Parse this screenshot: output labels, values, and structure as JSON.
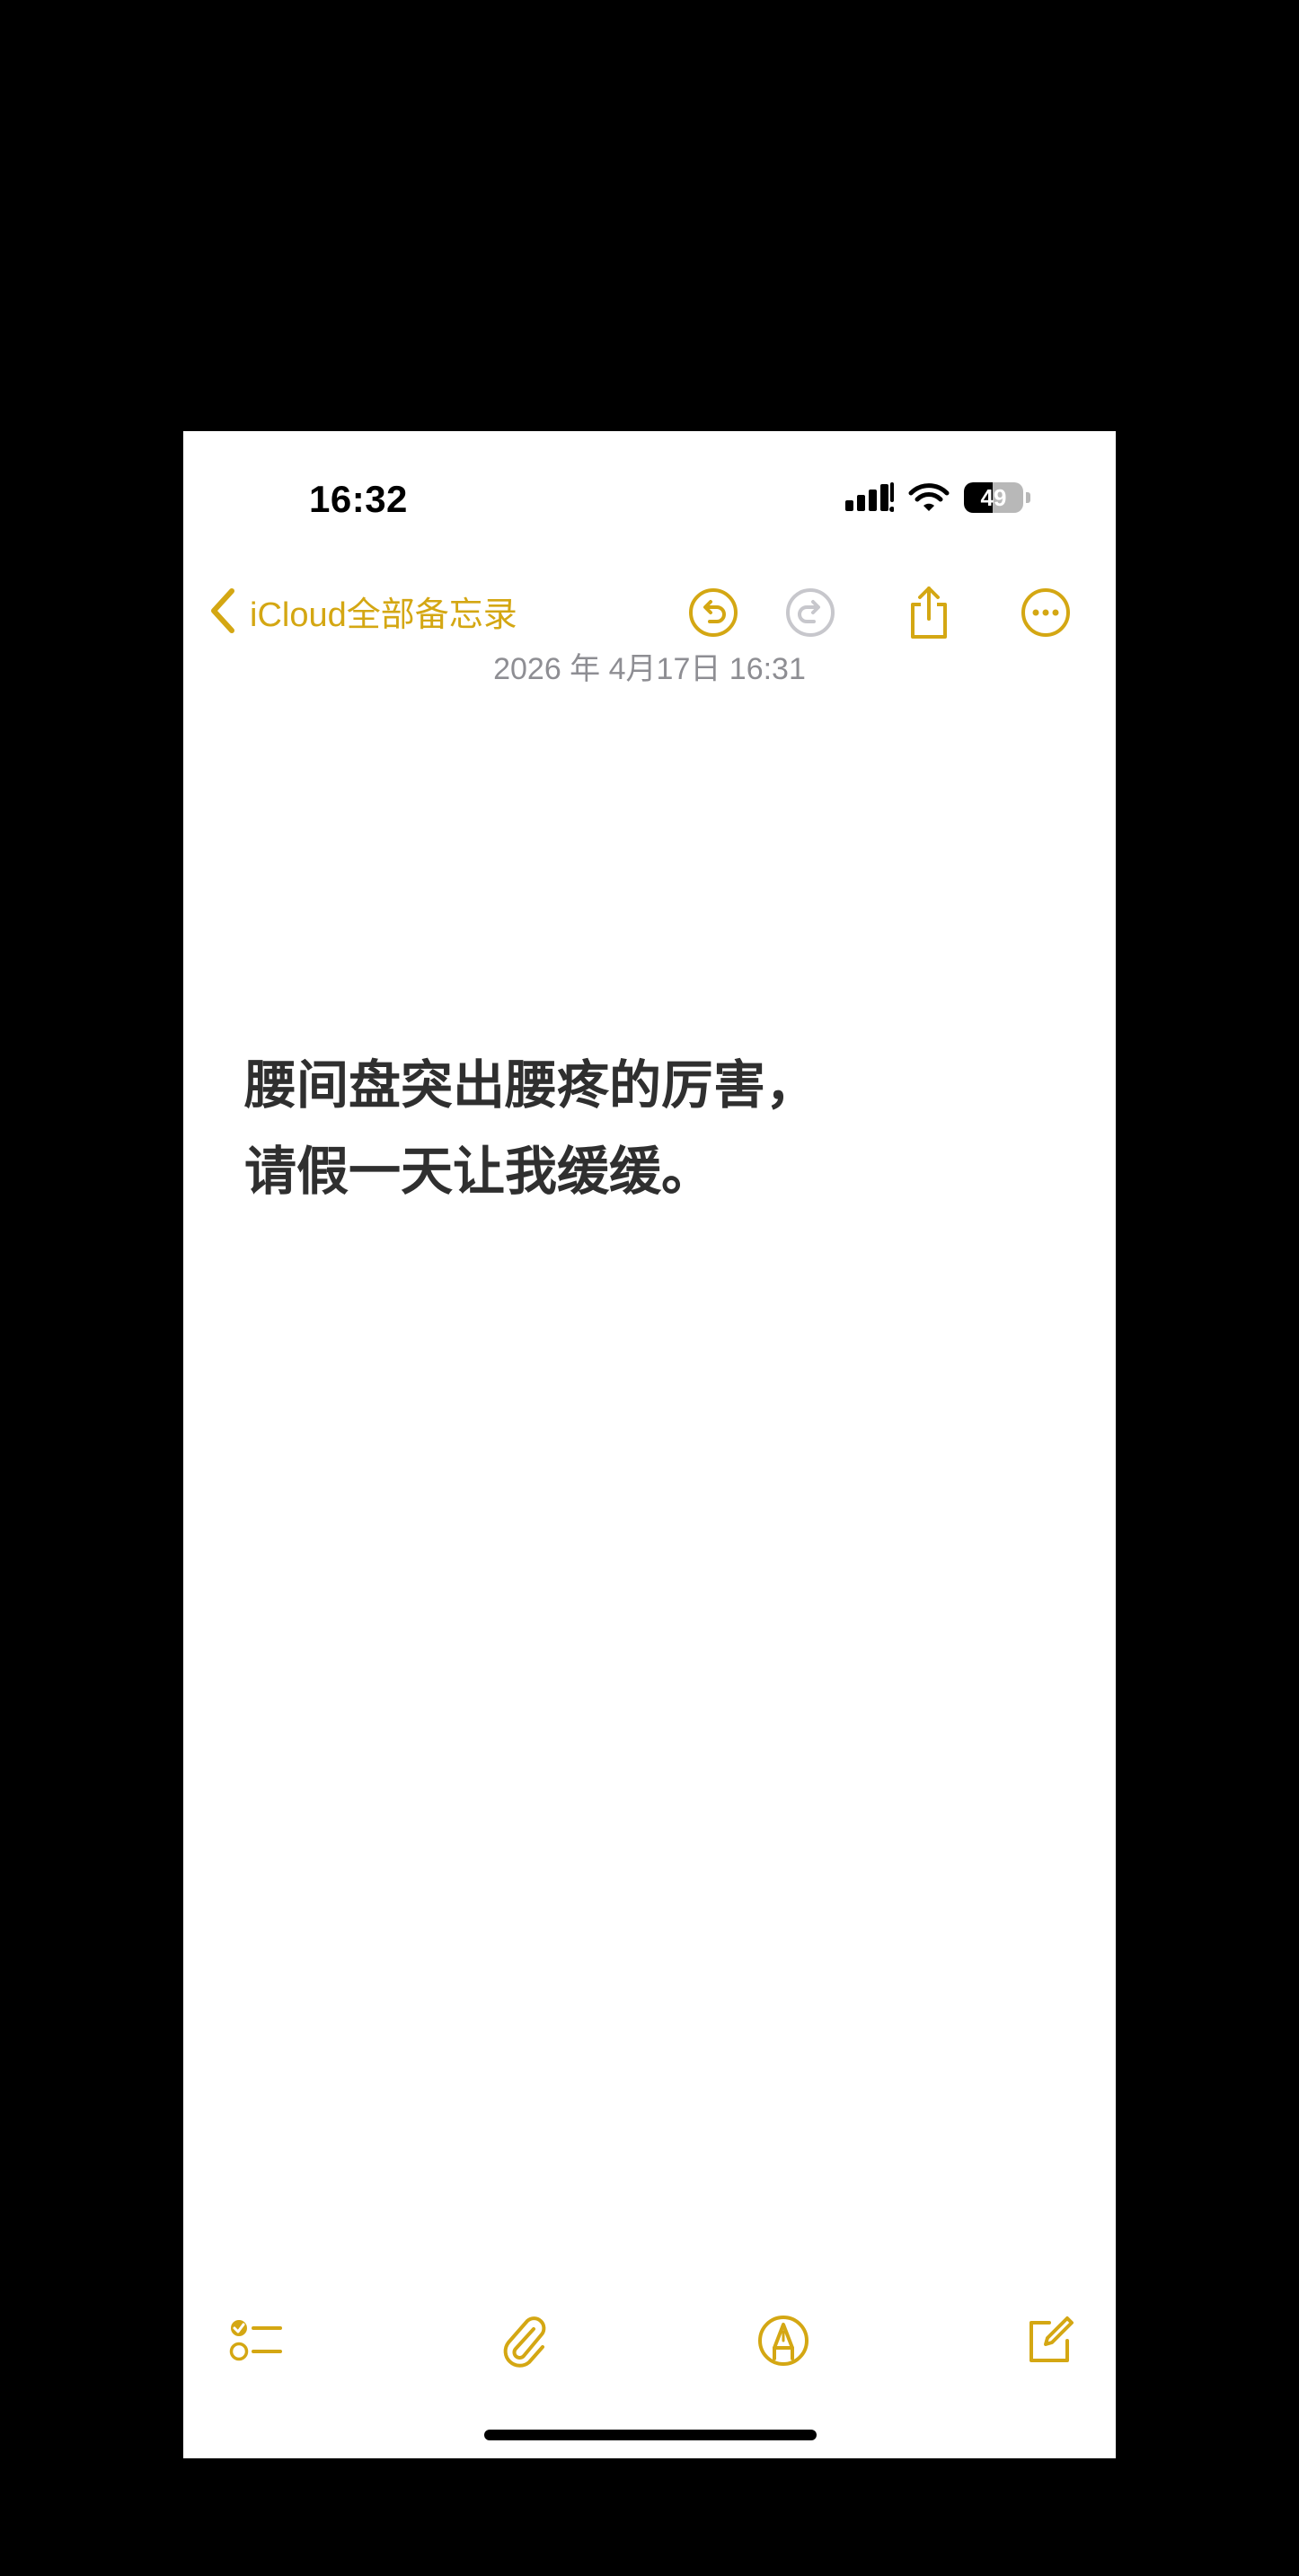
{
  "status_bar": {
    "time": "16:32",
    "battery": "49",
    "battery_level": 0.49,
    "icons": [
      "cellular-signal-icon",
      "wifi-icon",
      "battery-icon"
    ]
  },
  "nav": {
    "back_label": "iCloud全部备忘录",
    "icons": [
      "chevron-left-icon",
      "undo-icon",
      "redo-icon",
      "share-icon",
      "more-icon"
    ]
  },
  "note": {
    "date": "2026 年 4月17日 16:31",
    "lines": [
      "腰间盘突出腰疼的厉害，",
      "请假一天让我缓缓。"
    ]
  },
  "toolbar": {
    "icons": [
      "checklist-icon",
      "paperclip-icon",
      "markup-pen-icon",
      "compose-icon"
    ]
  },
  "colors": {
    "accent": "#d4a713",
    "disabled": "#c7c7cc",
    "text": "#2f2f2f",
    "secondary": "#8e8e93",
    "frame": "#000000",
    "background": "#ffffff"
  }
}
